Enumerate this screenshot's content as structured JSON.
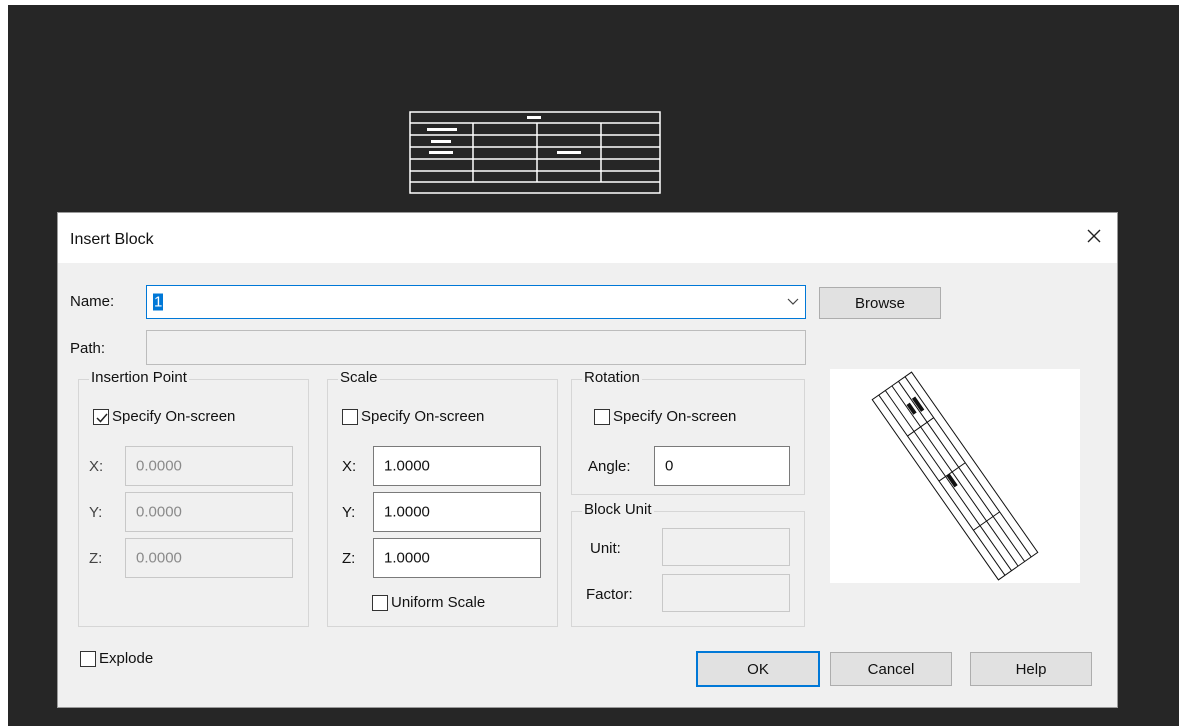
{
  "dialog": {
    "title": "Insert Block"
  },
  "name": {
    "label": "Name:",
    "value": "1"
  },
  "path": {
    "label": "Path:",
    "value": ""
  },
  "browse_label": "Browse",
  "insertion_point": {
    "title": "Insertion Point",
    "specify_label": "Specify On-screen",
    "specify_checked": true,
    "x_label": "X:",
    "x": "0.0000",
    "y_label": "Y:",
    "y": "0.0000",
    "z_label": "Z:",
    "z": "0.0000"
  },
  "scale": {
    "title": "Scale",
    "specify_label": "Specify On-screen",
    "specify_checked": false,
    "x_label": "X:",
    "x": "1.0000",
    "y_label": "Y:",
    "y": "1.0000",
    "z_label": "Z:",
    "z": "1.0000",
    "uniform_label": "Uniform Scale",
    "uniform_checked": false
  },
  "rotation": {
    "title": "Rotation",
    "specify_label": "Specify On-screen",
    "specify_checked": false,
    "angle_label": "Angle:",
    "angle": "0"
  },
  "block_unit": {
    "title": "Block Unit",
    "unit_label": "Unit:",
    "unit": "",
    "factor_label": "Factor:",
    "factor": ""
  },
  "explode": {
    "label": "Explode",
    "checked": false
  },
  "buttons": {
    "ok": "OK",
    "cancel": "Cancel",
    "help": "Help"
  }
}
